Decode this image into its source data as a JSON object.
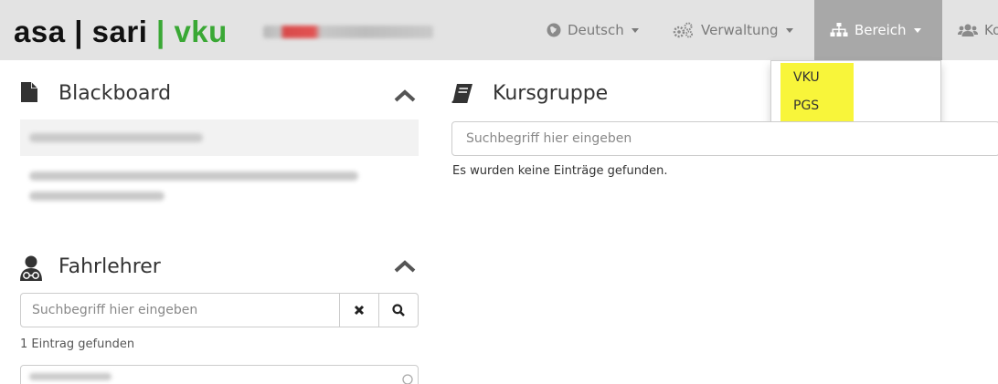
{
  "navbar": {
    "brand": {
      "part1": "asa",
      "sep1": "|",
      "part2": "sari",
      "sep2": "|",
      "part3": "vku"
    },
    "menu": {
      "language": {
        "label": "Deutsch",
        "icon": "globe-icon"
      },
      "administration": {
        "label": "Verwaltung",
        "icon": "cogs-icon"
      },
      "area": {
        "label": "Bereich",
        "icon": "sitemap-icon",
        "active": true
      },
      "contact": {
        "label": "Ko",
        "icon": "users-icon"
      }
    }
  },
  "area_dropdown": {
    "items": [
      {
        "label": "VKU"
      },
      {
        "label": "PGS"
      }
    ],
    "highlight_color": "#f8f53a"
  },
  "blackboard": {
    "title": "Blackboard",
    "icon": "file-icon"
  },
  "instructors": {
    "title": "Fahrlehrer",
    "icon": "user-md-icon",
    "search": {
      "placeholder": "Suchbegriff hier eingeben",
      "value": ""
    },
    "status": "1 Eintrag gefunden"
  },
  "course_group": {
    "title": "Kursgruppe",
    "icon": "book-icon",
    "search": {
      "placeholder": "Suchbegriff hier eingeben",
      "value": ""
    },
    "status": "Es wurden keine Einträge gefunden."
  },
  "colors": {
    "navbar_bg": "#e3e3e3",
    "brand_accent": "#3aa835",
    "active_nav_bg": "#a8a8a8"
  }
}
